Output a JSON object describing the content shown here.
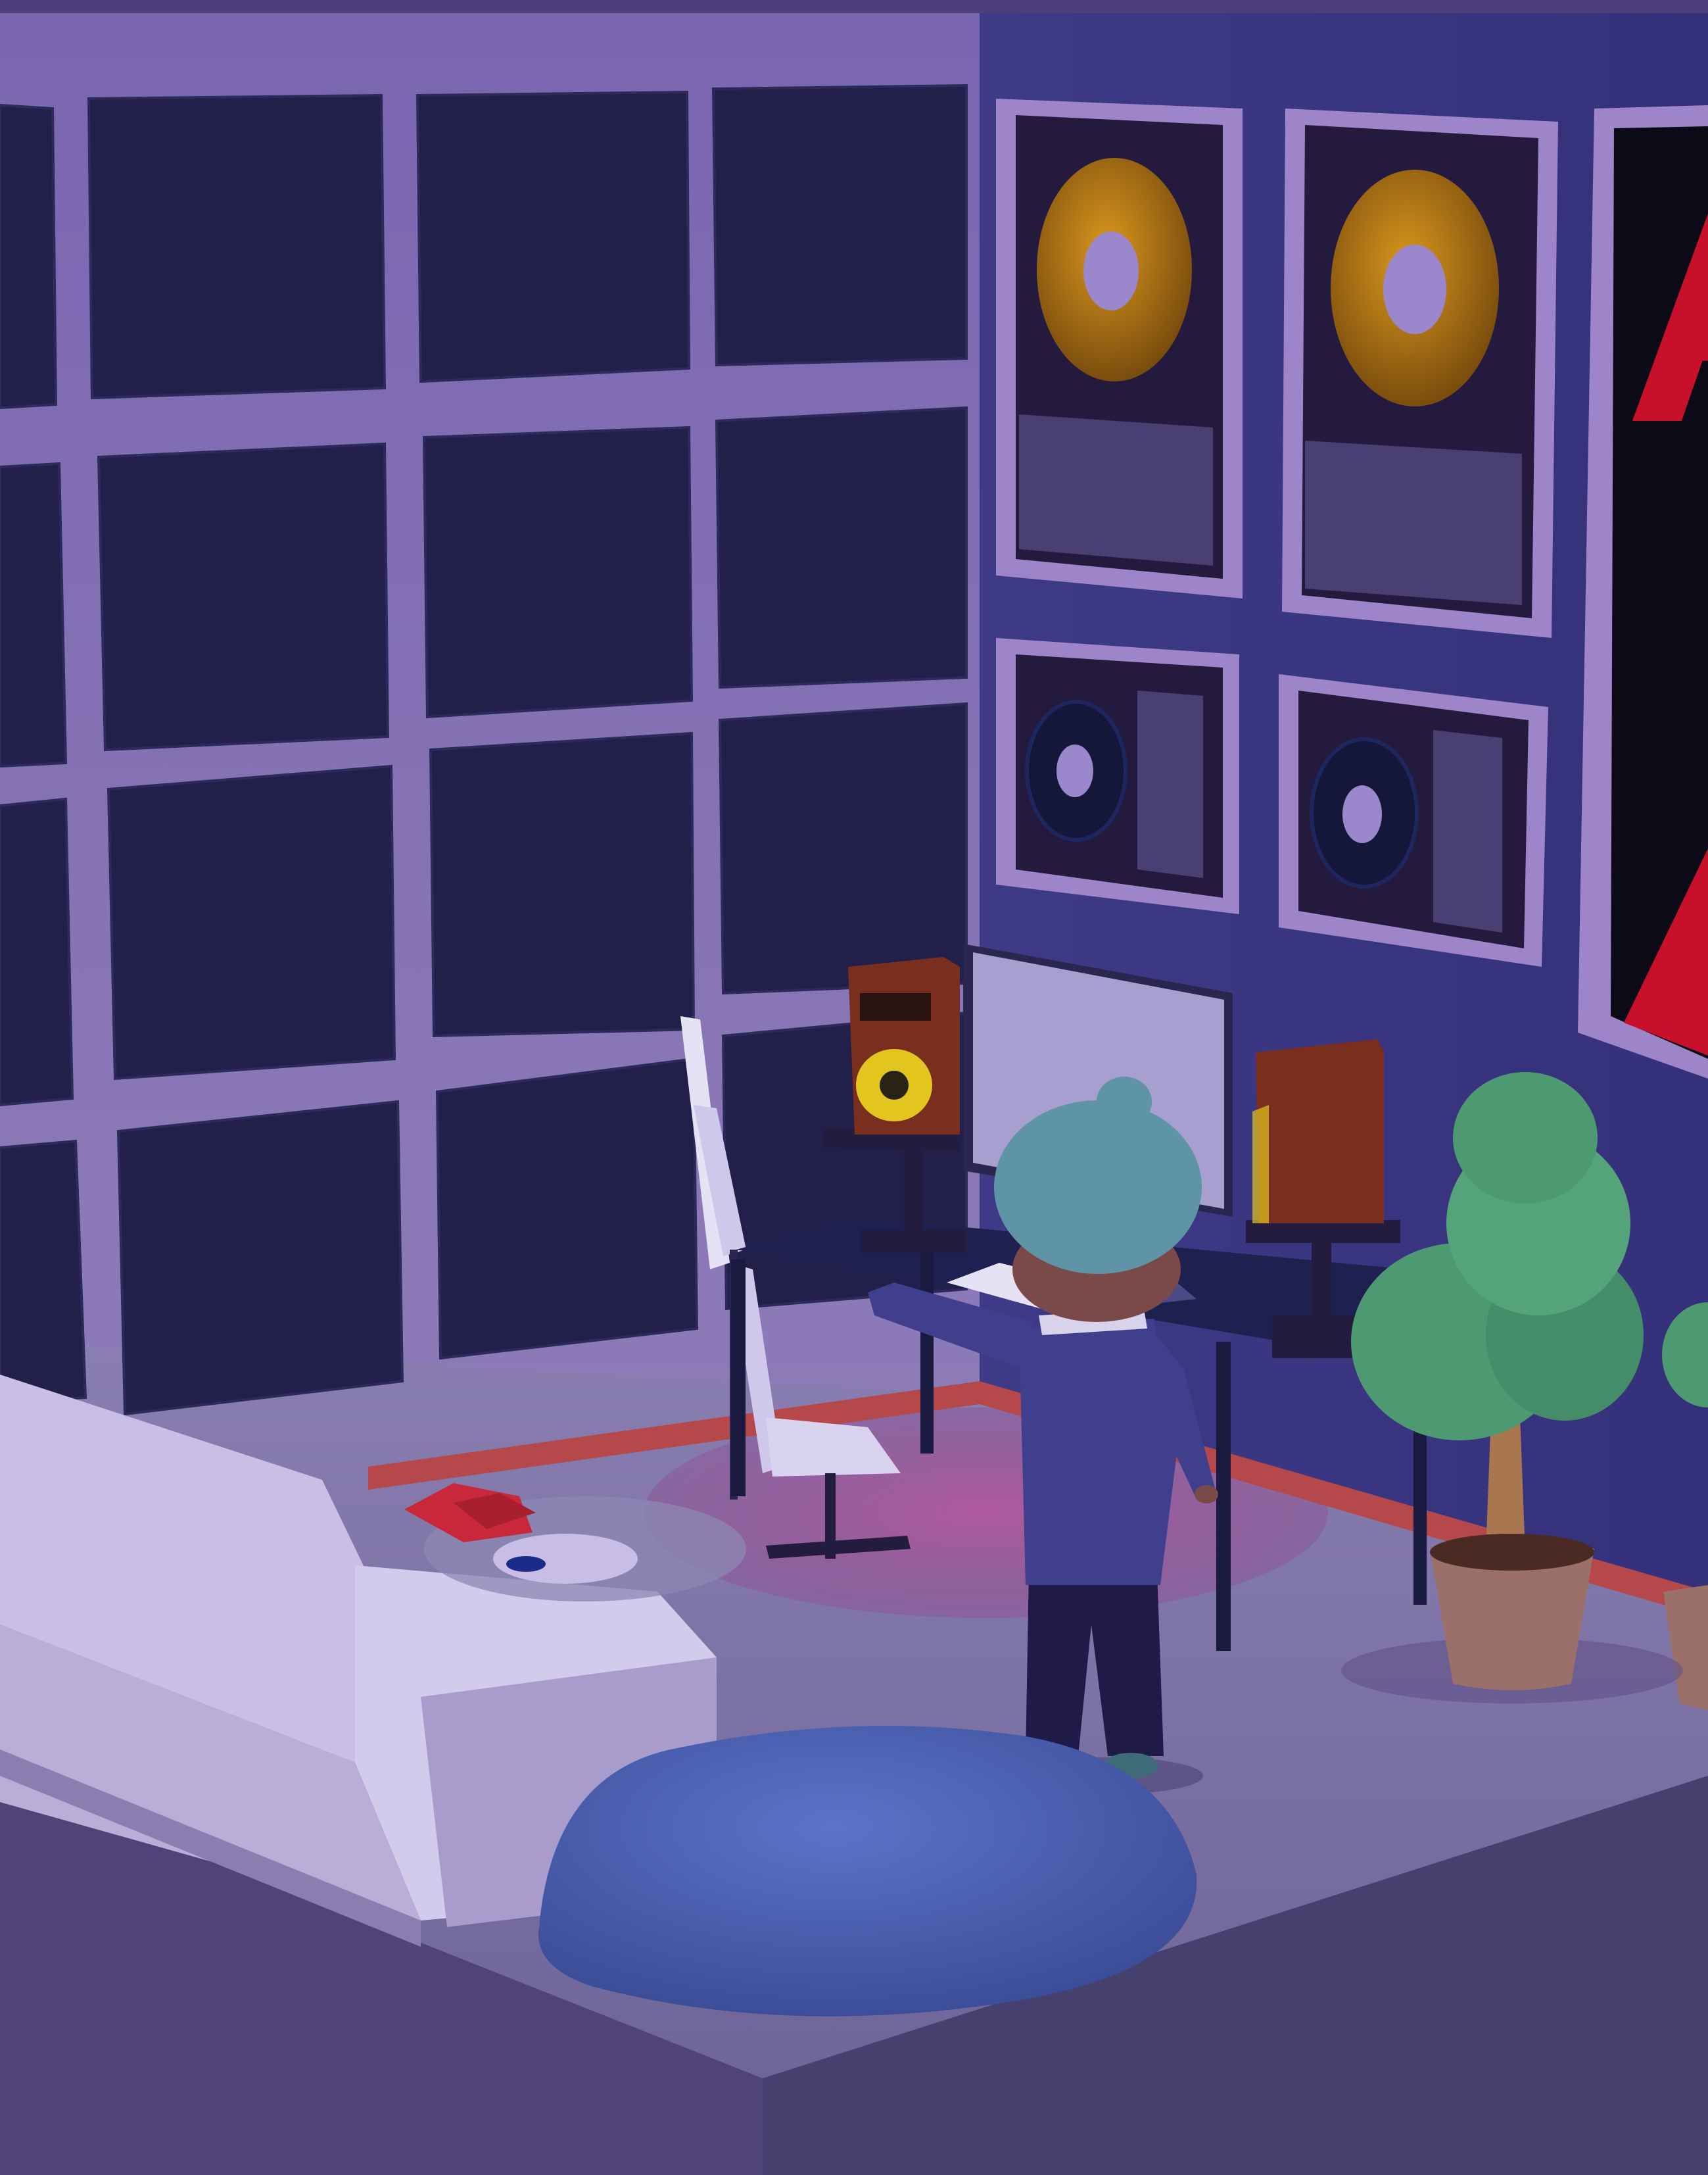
{
  "scene": {
    "description_name": "isometric-music-studio-room",
    "colors": {
      "left_wall": "#6f5ca8",
      "back_wall": "#3b3680",
      "panel": "#22204a",
      "floor": "#7e75a6",
      "floor_edge": "#5c4f86",
      "rug": "#a0528f",
      "baseboard": "#b4484a",
      "gold": "#b87a14",
      "record_dark": "#14173a",
      "poster_red": "#c8102b",
      "speaker_wood": "#7a2f1e",
      "speaker_yellow": "#e2c51e",
      "hat": "#5f94a6",
      "shirt": "#3f3f8e",
      "pants": "#1f1a48",
      "tree": "#4d9a72",
      "pot": "#9b6f6a",
      "sofa": "#cfc6e8",
      "beanbag": "#4a5fb0",
      "book_red": "#c8283a"
    },
    "poster_text": "A"
  }
}
